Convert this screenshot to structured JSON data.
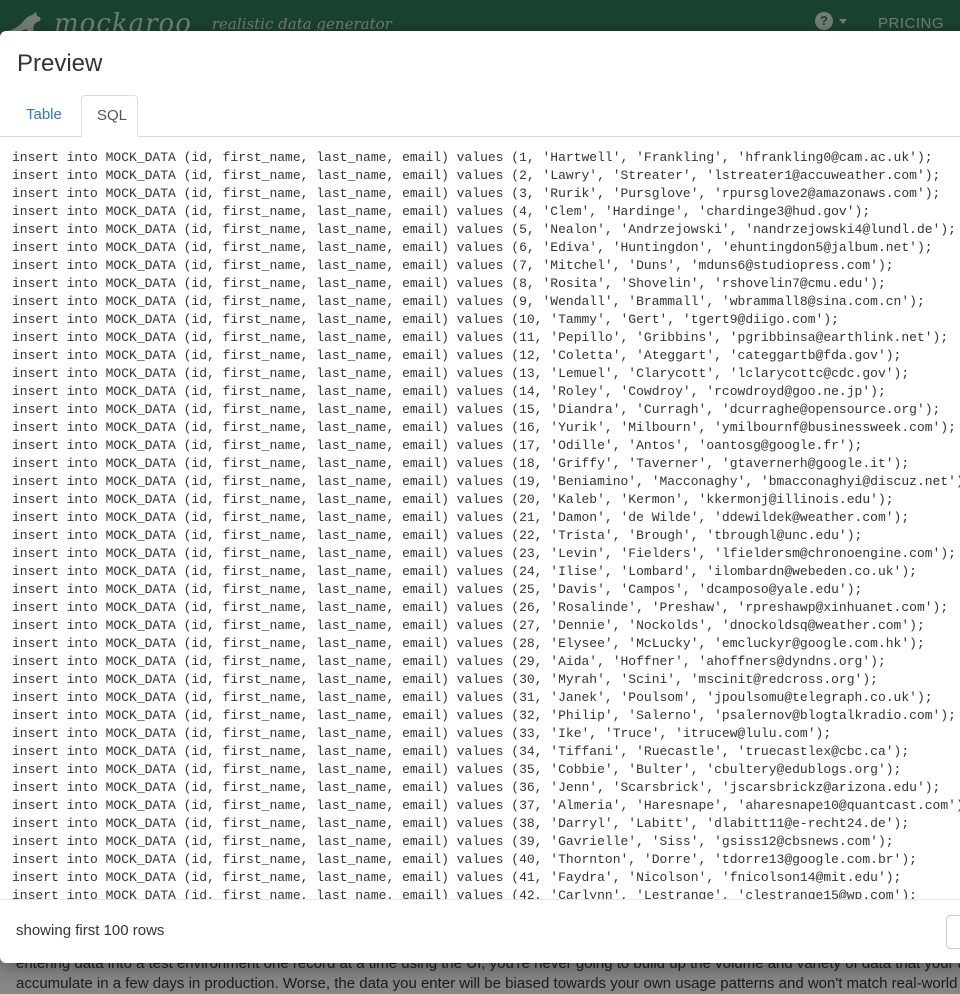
{
  "app": {
    "logo_text": "mockaroo",
    "tagline": "realistic data generator",
    "help_glyph": "?",
    "pricing": "PRICING"
  },
  "background": {
    "line1": "entering data into a test environment one record at a time using the UI, you're never going to build up the volume and variety of data that your ap",
    "line2": "accumulate in a few days in production. Worse, the data you enter will be biased towards your own usage patterns and won't match real-world us"
  },
  "modal": {
    "title": "Preview",
    "tabs": [
      {
        "label": "Table",
        "active": false
      },
      {
        "label": "SQL",
        "active": true
      }
    ],
    "footer_note": "showing first 100 rows"
  },
  "sql": {
    "table": "MOCK_DATA",
    "columns": [
      "id",
      "first_name",
      "last_name",
      "email"
    ],
    "rows": [
      [
        1,
        "Hartwell",
        "Frankling",
        "hfrankling0@cam.ac.uk"
      ],
      [
        2,
        "Lawry",
        "Streater",
        "lstreater1@accuweather.com"
      ],
      [
        3,
        "Rurik",
        "Pursglove",
        "rpursglove2@amazonaws.com"
      ],
      [
        4,
        "Clem",
        "Hardinge",
        "chardinge3@hud.gov"
      ],
      [
        5,
        "Nealon",
        "Andrzejowski",
        "nandrzejowski4@lundl.de"
      ],
      [
        6,
        "Ediva",
        "Huntingdon",
        "ehuntingdon5@jalbum.net"
      ],
      [
        7,
        "Mitchel",
        "Duns",
        "mduns6@studiopress.com"
      ],
      [
        8,
        "Rosita",
        "Shovelin",
        "rshovelin7@cmu.edu"
      ],
      [
        9,
        "Wendall",
        "Brammall",
        "wbrammall8@sina.com.cn"
      ],
      [
        10,
        "Tammy",
        "Gert",
        "tgert9@diigo.com"
      ],
      [
        11,
        "Pepillo",
        "Gribbins",
        "pgribbinsa@earthlink.net"
      ],
      [
        12,
        "Coletta",
        "Ateggart",
        "categgartb@fda.gov"
      ],
      [
        13,
        "Lemuel",
        "Clarycott",
        "lclarycottc@cdc.gov"
      ],
      [
        14,
        "Roley",
        "Cowdroy",
        "rcowdroyd@goo.ne.jp"
      ],
      [
        15,
        "Diandra",
        "Curragh",
        "dcurraghe@opensource.org"
      ],
      [
        16,
        "Yurik",
        "Milbourn",
        "ymilbournf@businessweek.com"
      ],
      [
        17,
        "Odille",
        "Antos",
        "oantosg@google.fr"
      ],
      [
        18,
        "Griffy",
        "Taverner",
        "gtavernerh@google.it"
      ],
      [
        19,
        "Beniamino",
        "Macconaghy",
        "bmacconaghyi@discuz.net"
      ],
      [
        20,
        "Kaleb",
        "Kermon",
        "kkermonj@illinois.edu"
      ],
      [
        21,
        "Damon",
        "de Wilde",
        "ddewildek@weather.com"
      ],
      [
        22,
        "Trista",
        "Brough",
        "tbroughl@unc.edu"
      ],
      [
        23,
        "Levin",
        "Fielders",
        "lfieldersm@chronoengine.com"
      ],
      [
        24,
        "Ilise",
        "Lombard",
        "ilombardn@webeden.co.uk"
      ],
      [
        25,
        "Davis",
        "Campos",
        "dcamposo@yale.edu"
      ],
      [
        26,
        "Rosalinde",
        "Preshaw",
        "rpreshawp@xinhuanet.com"
      ],
      [
        27,
        "Dennie",
        "Nockolds",
        "dnockoldsq@weather.com"
      ],
      [
        28,
        "Elysee",
        "McLucky",
        "emcluckyr@google.com.hk"
      ],
      [
        29,
        "Aida",
        "Hoffner",
        "ahoffners@dyndns.org"
      ],
      [
        30,
        "Myrah",
        "Scini",
        "mscinit@redcross.org"
      ],
      [
        31,
        "Janek",
        "Poulsom",
        "jpoulsomu@telegraph.co.uk"
      ],
      [
        32,
        "Philip",
        "Salerno",
        "psalernov@blogtalkradio.com"
      ],
      [
        33,
        "Ike",
        "Truce",
        "itrucew@lulu.com"
      ],
      [
        34,
        "Tiffani",
        "Ruecastle",
        "truecastlex@cbc.ca"
      ],
      [
        35,
        "Cobbie",
        "Bulter",
        "cbultery@edublogs.org"
      ],
      [
        36,
        "Jenn",
        "Scarsbrick",
        "jscarsbrickz@arizona.edu"
      ],
      [
        37,
        "Almeria",
        "Haresnape",
        "aharesnape10@quantcast.com"
      ],
      [
        38,
        "Darryl",
        "Labitt",
        "dlabitt11@e-recht24.de"
      ],
      [
        39,
        "Gavrielle",
        "Siss",
        "gsiss12@cbsnews.com"
      ],
      [
        40,
        "Thornton",
        "Dorre",
        "tdorre13@google.com.br"
      ],
      [
        41,
        "Faydra",
        "Nicolson",
        "fnicolson14@mit.edu"
      ],
      [
        42,
        "Carlynn",
        "Lestrange",
        "clestrange15@wp.com"
      ]
    ]
  },
  "colors": {
    "header_bg": "#2f7a54",
    "tab_link": "#337ab7"
  }
}
